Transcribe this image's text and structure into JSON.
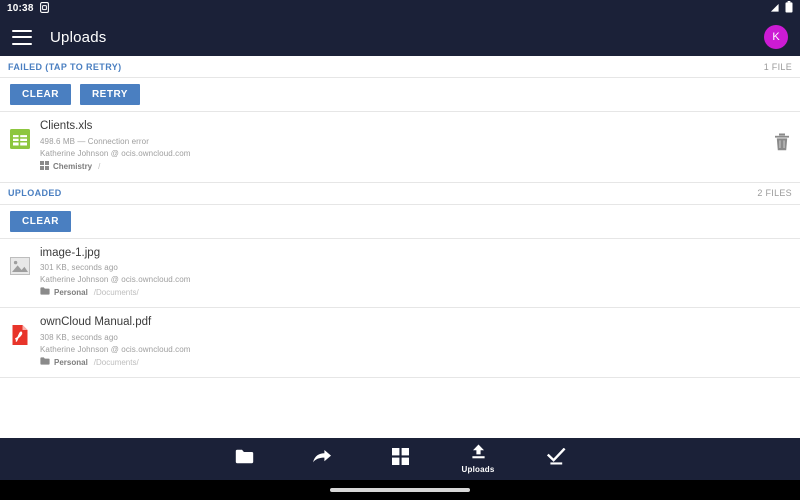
{
  "status_bar": {
    "time": "10:38",
    "left_icon": "sim-card-icon",
    "right_icons": [
      "signal-icon",
      "battery-icon"
    ]
  },
  "app_bar": {
    "menu_icon": "hamburger-menu-icon",
    "title": "Uploads",
    "avatar_initial": "K",
    "avatar_color": "#cc1bd4"
  },
  "colors": {
    "app_bar_bg": "#1b2138",
    "accent_blue": "#4a7fc1",
    "section_label": "#4a7fc1",
    "meta_gray": "#9e9e9e"
  },
  "sections": [
    {
      "id": "failed",
      "title": "FAILED (TAP TO RETRY)",
      "count": "1 FILE",
      "buttons": [
        {
          "label": "CLEAR",
          "name": "clear-failed-button"
        },
        {
          "label": "RETRY",
          "name": "retry-failed-button"
        }
      ],
      "files": [
        {
          "name": "Clients.xls",
          "meta": "498.6 MB — Connection error",
          "account": "Katherine Johnson @ ocis.owncloud.com",
          "space": "Chemistry",
          "path": "/",
          "icon": "spreadsheet-file-icon",
          "space_icon": "spaces-grid-icon",
          "action_icon": "delete-trash-icon"
        }
      ]
    },
    {
      "id": "uploaded",
      "title": "UPLOADED",
      "count": "2 FILES",
      "buttons": [
        {
          "label": "CLEAR",
          "name": "clear-uploaded-button"
        }
      ],
      "files": [
        {
          "name": "image-1.jpg",
          "meta": "301 KB, seconds ago",
          "account": "Katherine Johnson @ ocis.owncloud.com",
          "space": "Personal",
          "path": "/Documents/",
          "icon": "image-file-icon",
          "space_icon": "folder-icon",
          "action_icon": ""
        },
        {
          "name": "ownCloud Manual.pdf",
          "meta": "308 KB, seconds ago",
          "account": "Katherine Johnson @ ocis.owncloud.com",
          "space": "Personal",
          "path": "/Documents/",
          "icon": "pdf-file-icon",
          "space_icon": "folder-icon",
          "action_icon": ""
        }
      ]
    }
  ],
  "bottom_nav": {
    "items": [
      {
        "label": "",
        "icon": "folder-icon",
        "name": "nav-files",
        "active": false
      },
      {
        "label": "",
        "icon": "share-arrow-icon",
        "name": "nav-shares",
        "active": false
      },
      {
        "label": "",
        "icon": "spaces-grid-icon",
        "name": "nav-spaces",
        "active": false
      },
      {
        "label": "Uploads",
        "icon": "upload-icon",
        "name": "nav-uploads",
        "active": true
      },
      {
        "label": "",
        "icon": "check-available-offline-icon",
        "name": "nav-offline",
        "active": false
      }
    ]
  }
}
